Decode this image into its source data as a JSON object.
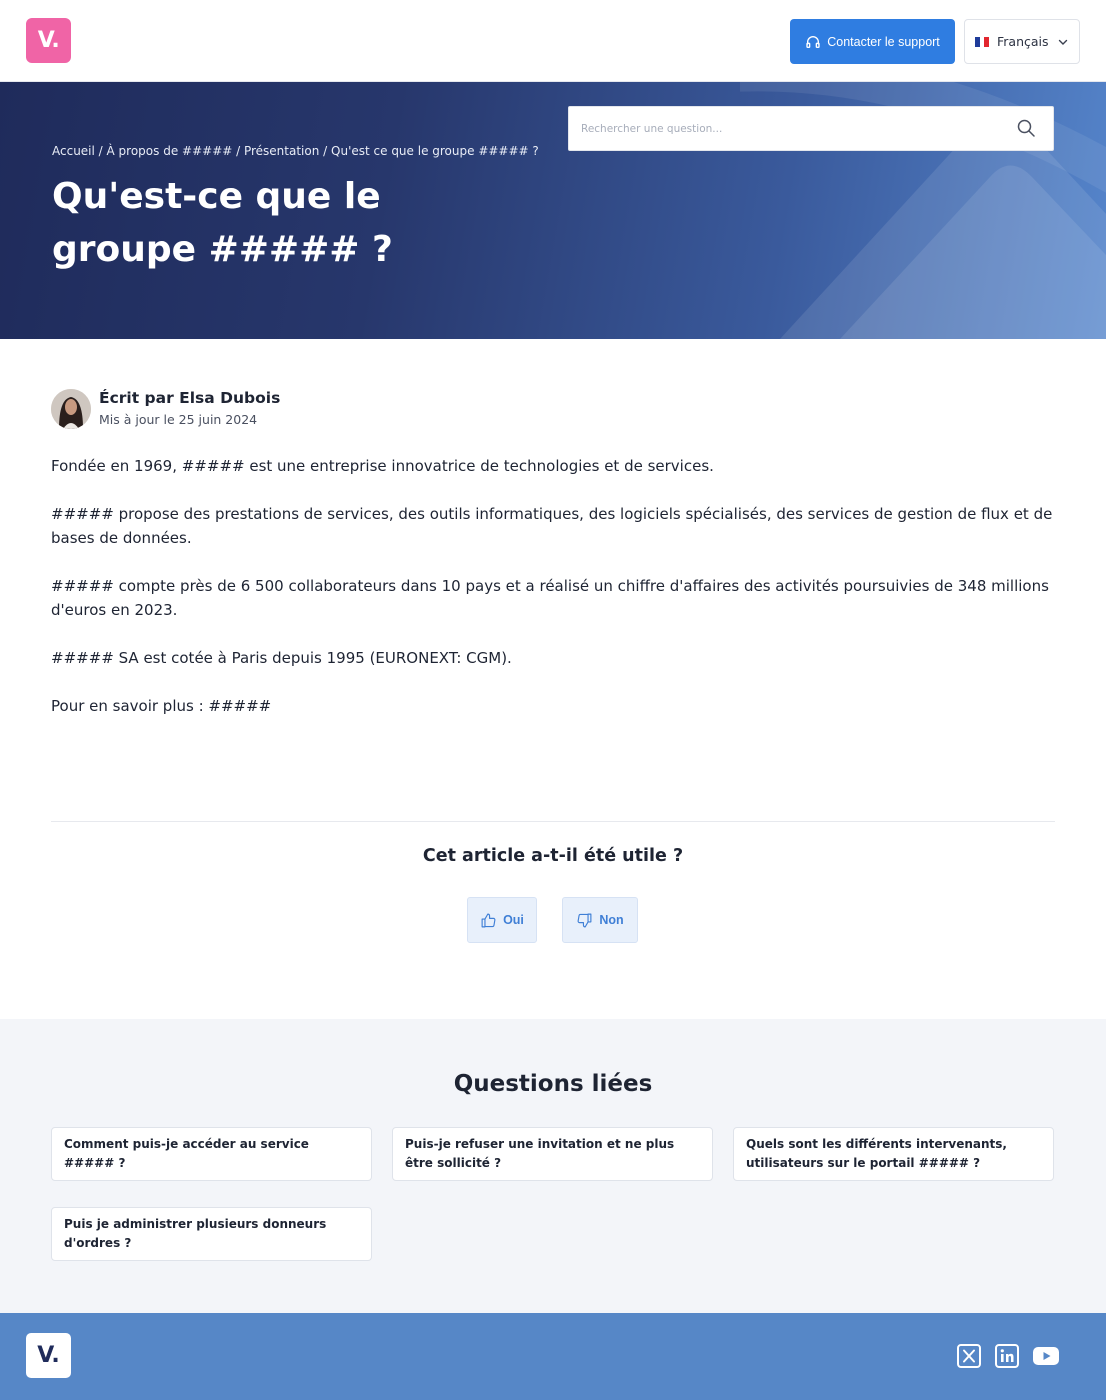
{
  "header": {
    "logo_text": "V.",
    "support_label": "Contacter le support",
    "language_label": "Français",
    "flag_colors": [
      "#1f3c9a",
      "#ffffff",
      "#e2262e"
    ]
  },
  "hero": {
    "breadcrumb": [
      "Accueil",
      "À propos de #####",
      "Présentation",
      "Qu'est ce que le groupe ##### ?"
    ],
    "title": "Qu'est-ce que le groupe ##### ?",
    "search_placeholder": "Rechercher une question..."
  },
  "author": {
    "name": "Écrit par Elsa Dubois",
    "updated": "Mis à jour le 25 juin 2024"
  },
  "article": {
    "paragraphs": [
      "Fondée en 1969, ##### est une entreprise innovatrice de technologies et de services.",
      "##### propose des prestations de services, des outils informatiques, des logiciels spécialisés, des services de gestion de flux et de bases de  données.",
      "##### compte près de 6 500 collaborateurs dans 10 pays et a réalisé un chiffre d'affaires des activités poursuivies de 348 millions d'euros en 2023.",
      "##### SA est cotée à Paris depuis 1995 (EURONEXT: CGM).",
      "Pour en savoir plus : #####"
    ]
  },
  "feedback": {
    "question": "Cet article a-t-il été utile ?",
    "yes_label": "Oui",
    "no_label": "Non"
  },
  "related": {
    "title": "Questions liées",
    "items": [
      "Comment puis-je accéder au service ##### ?",
      "Puis-je refuser une invitation et ne plus être sollicité ?",
      "Quels sont les différents intervenants, utilisateurs sur le portail ##### ?",
      "Puis je administrer plusieurs donneurs d'ordres ?"
    ]
  },
  "footer": {
    "logo_text": "V.",
    "social_icons": [
      "x-icon",
      "linkedin-icon",
      "youtube-icon"
    ]
  },
  "colors": {
    "brand_pink": "#f064a6",
    "primary_blue": "#2f7de1",
    "hero_dark": "#1f2b5b",
    "footer_blue": "#5687c7"
  }
}
